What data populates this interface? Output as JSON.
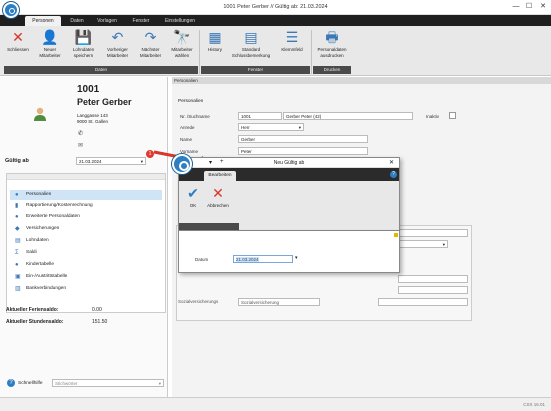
{
  "window": {
    "title": "1001 Peter Gerber // Gültig ab: 21.03.2024",
    "minimize": "—",
    "maximize": "☐",
    "close": "✕"
  },
  "ribbon_tabs": [
    "Personen",
    "Daten",
    "Vorlagen",
    "Fenster",
    "Einstellungen"
  ],
  "ribbon_buttons": [
    {
      "label": "Schliessen",
      "icon": "close-icon",
      "glyph": "✕",
      "color": "#d9352a"
    },
    {
      "label": "Neuer\nMitarbeiter",
      "icon": "new-user-icon",
      "glyph": "👤",
      "color": "#3b78b5"
    },
    {
      "label": "Lohndaten\nspeichern",
      "icon": "save-icon",
      "glyph": "💾",
      "color": "#3b78b5"
    },
    {
      "label": "Vorheriger\nMitarbeiter",
      "icon": "previous-icon",
      "glyph": "↶",
      "color": "#3b78b5"
    },
    {
      "label": "Nächster\nMitarbeiter",
      "icon": "next-icon",
      "glyph": "↷",
      "color": "#3b78b5"
    },
    {
      "label": "Mitarbeiter\nwählen",
      "icon": "binoculars-icon",
      "glyph": "🔭",
      "color": "#3b78b5"
    },
    {
      "label": "History",
      "icon": "history-icon",
      "glyph": "▦",
      "color": "#3b78b5"
    },
    {
      "label": "Standard\nSchlussbemerkung",
      "icon": "document-icon",
      "glyph": "▤",
      "color": "#3b78b5"
    },
    {
      "label": "Klemmfeld",
      "icon": "list-icon",
      "glyph": "☰",
      "color": "#3b78b5"
    },
    {
      "label": "Personaldaten\nausdrucken",
      "icon": "print-icon",
      "glyph": "🖶",
      "color": "#3b78b5"
    }
  ],
  "ribbon_groups": [
    "Daten",
    "Fenster",
    "Drucken"
  ],
  "employee": {
    "number": "1001",
    "name": "Peter Gerber",
    "street": "Langgasse 143",
    "city": "9000 St. Gallen",
    "phone_icon": "✆",
    "mail_icon": "✉"
  },
  "valid_from": {
    "label": "Gültig ab",
    "value": "21.03.2024"
  },
  "nav_items": [
    {
      "label": "Personalien",
      "icon": "person-icon",
      "glyph": "●"
    },
    {
      "label": "Rapportierung/Kostenrechnung",
      "icon": "report-icon",
      "glyph": "▮"
    },
    {
      "label": "Erweiterte Personaldaten",
      "icon": "person-extended-icon",
      "glyph": "●"
    },
    {
      "label": "Versicherungen",
      "icon": "shield-icon",
      "glyph": "◆"
    },
    {
      "label": "Lohndaten",
      "icon": "money-icon",
      "glyph": "▤"
    },
    {
      "label": "Saldi",
      "icon": "sigma-icon",
      "glyph": "Σ"
    },
    {
      "label": "Kindertabelle",
      "icon": "child-icon",
      "glyph": "●"
    },
    {
      "label": "Ein-/Austrittstabelle",
      "icon": "entry-exit-icon",
      "glyph": "▣"
    },
    {
      "label": "Bankverbindungen",
      "icon": "bank-icon",
      "glyph": "▥"
    }
  ],
  "balances": [
    {
      "label": "Aktueller Feriensaldo:",
      "value": "0.00"
    },
    {
      "label": "Aktueller Stundensaldo:",
      "value": "151.50"
    }
  ],
  "quick_help": {
    "label": "Schnellhilfe",
    "placeholder": "Stichwörter"
  },
  "main": {
    "section": "Personalien",
    "subsection": "Personalien",
    "fields": [
      {
        "label": "Nr. /Suchname",
        "value": "1001",
        "value2": "Gerber Peter (42)"
      },
      {
        "label": "Anrede",
        "value": "Herr"
      },
      {
        "label": "Name",
        "value": "Gerber"
      },
      {
        "label": "Vorname",
        "value": "Peter"
      }
    ],
    "inactive_label": "Inaktiv",
    "lower_label": "Sozialversicherungs",
    "lower_value": "Sozialversicherung"
  },
  "dialog": {
    "title": "Neu Gültig ab",
    "tab": "Bearbeiten",
    "ok": "OK",
    "cancel": "Abbrechen",
    "date_label": "Datum",
    "date_value": "21.03.2024"
  },
  "callout": "1",
  "status_right": "CSX 16.01"
}
